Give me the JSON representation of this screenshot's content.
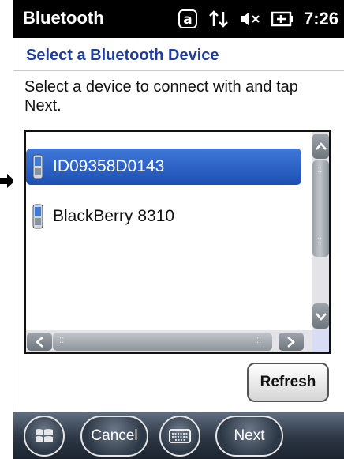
{
  "status_bar": {
    "title": "Bluetooth",
    "time": "7:26",
    "icons": [
      "a-key-icon",
      "connectivity-arrows-icon",
      "speaker-muted-icon",
      "battery-charging-icon"
    ]
  },
  "header": {
    "title": "Select a Bluetooth Device"
  },
  "instructions": "Select a device to connect with and tap Next.",
  "device_list": {
    "items": [
      {
        "label": "ID09358D0143",
        "icon": "phone-icon",
        "selected": true
      },
      {
        "label": "BlackBerry 8310",
        "icon": "phone-icon",
        "selected": false
      }
    ]
  },
  "buttons": {
    "refresh": "Refresh"
  },
  "taskbar": {
    "start_icon": "windows-logo-icon",
    "cancel": "Cancel",
    "keyboard_icon": "keyboard-icon",
    "next": "Next"
  },
  "colors": {
    "title_blue": "#1d3d9f",
    "selection_blue": "#2a5dc4",
    "status_bar": "#000000"
  }
}
